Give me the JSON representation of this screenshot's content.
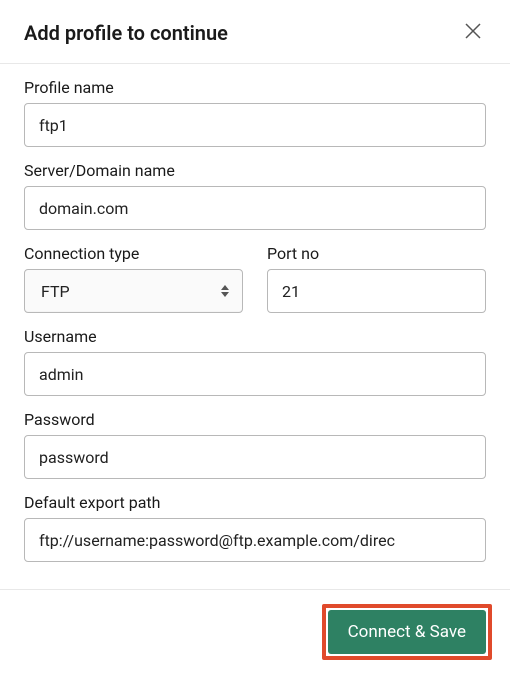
{
  "header": {
    "title": "Add profile to continue"
  },
  "form": {
    "profile_name": {
      "label": "Profile name",
      "value": "ftp1"
    },
    "server_domain": {
      "label": "Server/Domain name",
      "value": "domain.com"
    },
    "connection_type": {
      "label": "Connection type",
      "value": "FTP"
    },
    "port": {
      "label": "Port no",
      "value": "21"
    },
    "username": {
      "label": "Username",
      "value": "admin"
    },
    "password": {
      "label": "Password",
      "value": "password"
    },
    "export_path": {
      "label": "Default export path",
      "value": "ftp://username:password@ftp.example.com/direc"
    }
  },
  "footer": {
    "connect_label": "Connect & Save"
  }
}
